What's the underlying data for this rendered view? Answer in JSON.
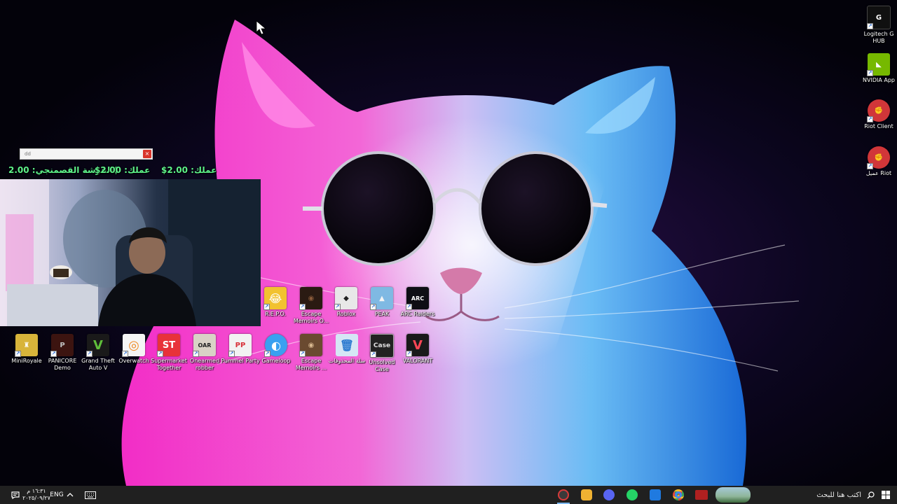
{
  "desktop": {
    "right_icons": [
      {
        "label": "Logitech G HUB",
        "color": "#101010",
        "glyph": "G"
      },
      {
        "label": "NVIDIA App",
        "color": "#76b900",
        "glyph": "◣"
      },
      {
        "label": "Riot Client",
        "color": "#d13639",
        "glyph": "✊"
      },
      {
        "label": "عميل Riot",
        "color": "#d13639",
        "glyph": "✊"
      }
    ],
    "row1_icons": [
      {
        "label": "R.E.P.O.",
        "color": "#f2c230",
        "glyph": "😂"
      },
      {
        "label": "Escape Memoirs O...",
        "color": "#2a1a12",
        "glyph": "◉"
      },
      {
        "label": "Roblox",
        "color": "#e8e8e8",
        "glyph": "◆"
      },
      {
        "label": "PEAK",
        "color": "#7fb9e3",
        "glyph": "▲"
      },
      {
        "label": "ARC Raiders",
        "color": "#0e0e14",
        "glyph": "ARC"
      }
    ],
    "row2_icons": [
      {
        "label": "MiniRoyale",
        "color": "#d8b43a",
        "glyph": "♜"
      },
      {
        "label": "PANICORE Demo",
        "color": "#3c1410",
        "glyph": "P"
      },
      {
        "label": "Grand Theft Auto V",
        "color": "#1a1a1a",
        "glyph": "V"
      },
      {
        "label": "Overwatch",
        "color": "#f5f5f5",
        "glyph": "◎"
      },
      {
        "label": "Supermarket Together",
        "color": "#e8323a",
        "glyph": "ST"
      },
      {
        "label": "Onearmed robber",
        "color": "#d9d2c6",
        "glyph": "OAR"
      },
      {
        "label": "Pummel Party",
        "color": "#f2f2f2",
        "glyph": "PP"
      },
      {
        "label": "Gameloop",
        "color": "#3aa0f0",
        "glyph": "◐"
      },
      {
        "label": "Escape Memoirs ...",
        "color": "#6a4a30",
        "glyph": "◉"
      },
      {
        "label": "سلة المحذوفات",
        "color": "#d5e6f5",
        "glyph": "🗑"
      },
      {
        "label": "Unsolved Case",
        "color": "#222222",
        "glyph": "Case"
      },
      {
        "label": "VALORANT",
        "color": "#1a1a1a",
        "glyph": "V"
      }
    ]
  },
  "overlay": {
    "input_value": "dd",
    "close_glyph": "×",
    "donations": [
      {
        "text": "الفرشة القصمنجي: 2.00$"
      },
      {
        "text": "عملك: 2.00$"
      },
      {
        "text": "عملك: 2.00$"
      }
    ]
  },
  "taskbar": {
    "clock_time": "١٦:٣١ م",
    "clock_date": "٢٠٢٥/٠٩/٢٧",
    "language": "ENG",
    "search_placeholder": "اكتب هنا للبحث",
    "apps": [
      {
        "name": "obs-app",
        "color": "#3a3a3a",
        "active": true
      },
      {
        "name": "discord-app",
        "color": "#f0b232",
        "active": false
      },
      {
        "name": "chat-app",
        "color": "#5865f2",
        "active": false
      },
      {
        "name": "whatsapp-app",
        "color": "#25d366",
        "active": false
      },
      {
        "name": "mail-app",
        "color": "#1f7ae0",
        "active": false
      },
      {
        "name": "chrome-app",
        "color": "#e8453c",
        "active": false
      },
      {
        "name": "stream-app",
        "color": "#b02020",
        "active": false
      }
    ],
    "colors": {
      "bar": "#202020",
      "accent": "#7db8f0"
    }
  }
}
